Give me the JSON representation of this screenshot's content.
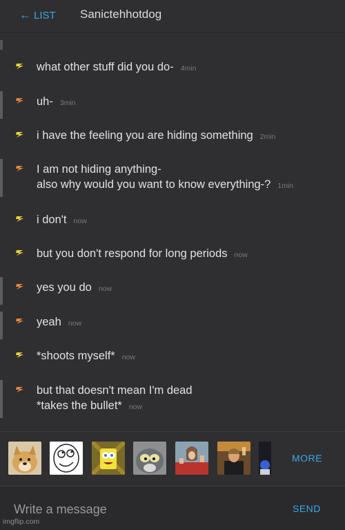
{
  "header": {
    "back_arrow": "←",
    "back_label": "LIST",
    "title": "Sanictehhotdog"
  },
  "colors": {
    "accent": "#39a9e8",
    "own_bolt": "#e8d33a",
    "other_bolt": "#e8863a",
    "background": "#2f2f31"
  },
  "messages": [
    {
      "text": "what other stuff did you do-",
      "time": "4min",
      "sender": "me"
    },
    {
      "text": "uh-",
      "time": "3min",
      "sender": "them"
    },
    {
      "text": "i have the feeling you are hiding something",
      "time": "2min",
      "sender": "me"
    },
    {
      "line1": "I am not hiding anything-",
      "text": "also why would you want to know everything-?",
      "time": "1min",
      "sender": "them"
    },
    {
      "text": "i don't",
      "time": "now",
      "sender": "me"
    },
    {
      "text": "but you don't respond for long periods",
      "time": "now",
      "sender": "me"
    },
    {
      "text": "yes you do",
      "time": "now",
      "sender": "them"
    },
    {
      "text": "yeah",
      "time": "now",
      "sender": "them"
    },
    {
      "text": "*shoots myself*",
      "time": "now",
      "sender": "me"
    },
    {
      "line1": "but that doesn't mean I'm dead",
      "text": "*takes the bullet*",
      "time": "now",
      "sender": "them"
    }
  ],
  "stickers": [
    "doge-sticker",
    "derp-face-sticker",
    "spongebob-imagination-sticker",
    "tom-cat-sticker",
    "buddy-christ-sticker",
    "leonardo-toast-sticker",
    "partial-sticker"
  ],
  "more_label": "MORE",
  "composer": {
    "placeholder": "Write a message",
    "send_label": "SEND"
  },
  "watermark": "imgflip.com"
}
